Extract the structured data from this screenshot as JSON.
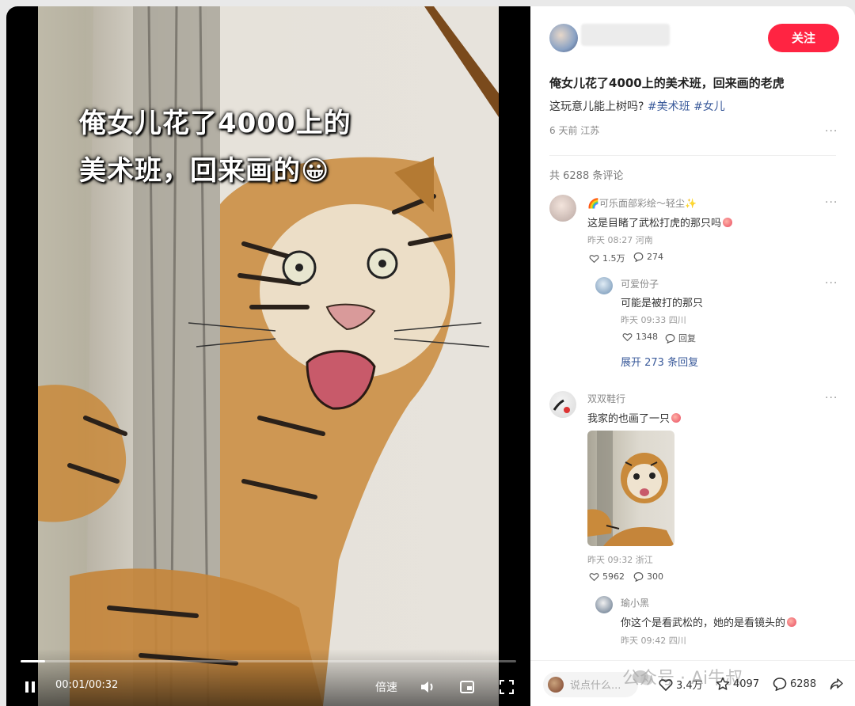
{
  "video": {
    "caption_line1": "俺女儿花了4000上的",
    "caption_line2": "美术班，回来画的",
    "caption_emoji": "😀",
    "current_time": "00:01",
    "duration": "00:32",
    "time_display": "00:01/00:32",
    "progress_fraction": 0.05,
    "speed_label": "倍速"
  },
  "post": {
    "follow_label": "关注",
    "title": "俺女儿花了4000上的美术班，回来画的老虎",
    "desc_text": "这玩意儿能上树吗? ",
    "tags": [
      "#美术班",
      "#女儿"
    ],
    "meta": "6 天前 江苏",
    "more_label": "···"
  },
  "comments_header": "共 6288 条评论",
  "comments": [
    {
      "name": "🌈可乐面部彩绘～轻尘✨",
      "text": "这是目睹了武松打虎的那只吗",
      "meta": "昨天 08:27 河南",
      "likes": "1.5万",
      "replies_count": "274"
    },
    {
      "name": "可爱份子",
      "text": "可能是被打的那只",
      "meta": "昨天 09:33 四川",
      "likes": "1348",
      "reply_label": "回复"
    },
    {
      "name": "双双鞋行",
      "text": "我家的也画了一只",
      "meta": "昨天 09:32 浙江",
      "likes": "5962",
      "replies_count": "300"
    },
    {
      "name": "瑜小黑",
      "text": "你这个是看武松的，她的是看镜头的",
      "meta": "昨天 09:42 四川"
    }
  ],
  "expand_label": "展开 273 条回复",
  "bottom_bar": {
    "input_placeholder": "说点什么...",
    "likes": "3.4万",
    "stars": "4097",
    "comments": "6288",
    "watermark": "公众号 · Ai牛叔"
  },
  "colors": {
    "accent": "#ff2442",
    "tag_blue": "#3b5b9b",
    "video_bg": "#000000"
  },
  "icons": [
    "pause-icon",
    "volume-icon",
    "pip-icon",
    "fullscreen-icon",
    "heart-icon",
    "comment-icon",
    "star-icon",
    "share-icon",
    "more-icon"
  ]
}
